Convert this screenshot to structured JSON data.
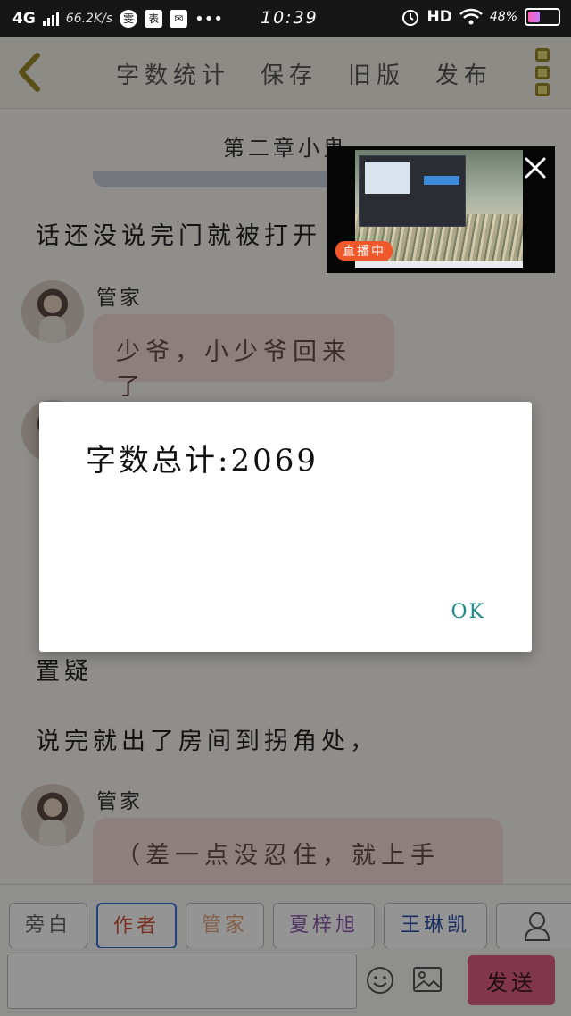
{
  "status_bar": {
    "network": "4G",
    "speed": "66.2K/s",
    "app_icon_1": "雯",
    "app_icon_2": "表",
    "app_icon_3": "✉",
    "dots": "•••",
    "time": "10:39",
    "hd": "HD",
    "battery_percent": "48%",
    "battery_level": 0.48
  },
  "toolbar": {
    "word_count_label": "字数统计",
    "save_label": "保存",
    "old_version_label": "旧版",
    "publish_label": "发布"
  },
  "chat": {
    "chapter_title": "第二章小鬼",
    "narration_1": "话还没说完门就被打开",
    "speaker_1": "管家",
    "bubble_1": "少爷，小少爷回来了",
    "narration_2": "置疑",
    "narration_3": "说完就出了房间到拐角处，",
    "speaker_2": "管家",
    "bubble_2": "（差一点没忍住，就上手"
  },
  "video_popup": {
    "live_badge": "直播中"
  },
  "dialog": {
    "message": "字数总计:2069",
    "ok_label": "OK"
  },
  "roles": [
    {
      "label": "旁白",
      "color": "#666666"
    },
    {
      "label": "作者",
      "color": "#d2553e"
    },
    {
      "label": "管家",
      "color": "#e0a27a"
    },
    {
      "label": "夏梓旭",
      "color": "#8b5aa8"
    },
    {
      "label": "王琳凯",
      "color": "#2c4ea6"
    }
  ],
  "input": {
    "placeholder": "",
    "send_label": "发送"
  },
  "colors": {
    "accent_blue": "#3c6fd8",
    "send_pink": "#e05e86",
    "ok_teal": "#1e8a8a"
  }
}
